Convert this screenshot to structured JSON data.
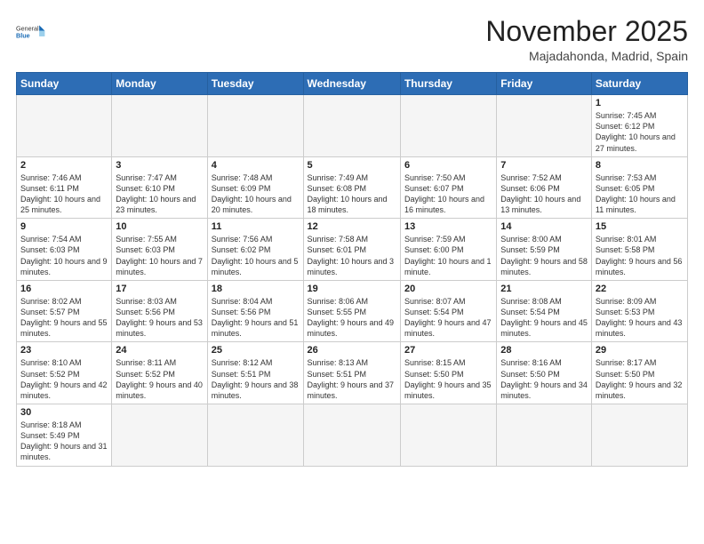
{
  "logo": {
    "text_general": "General",
    "text_blue": "Blue"
  },
  "header": {
    "month_year": "November 2025",
    "location": "Majadahonda, Madrid, Spain"
  },
  "weekdays": [
    "Sunday",
    "Monday",
    "Tuesday",
    "Wednesday",
    "Thursday",
    "Friday",
    "Saturday"
  ],
  "weeks": [
    [
      {
        "day": "",
        "info": ""
      },
      {
        "day": "",
        "info": ""
      },
      {
        "day": "",
        "info": ""
      },
      {
        "day": "",
        "info": ""
      },
      {
        "day": "",
        "info": ""
      },
      {
        "day": "",
        "info": ""
      },
      {
        "day": "1",
        "info": "Sunrise: 7:45 AM\nSunset: 6:12 PM\nDaylight: 10 hours and 27 minutes."
      }
    ],
    [
      {
        "day": "2",
        "info": "Sunrise: 7:46 AM\nSunset: 6:11 PM\nDaylight: 10 hours and 25 minutes."
      },
      {
        "day": "3",
        "info": "Sunrise: 7:47 AM\nSunset: 6:10 PM\nDaylight: 10 hours and 23 minutes."
      },
      {
        "day": "4",
        "info": "Sunrise: 7:48 AM\nSunset: 6:09 PM\nDaylight: 10 hours and 20 minutes."
      },
      {
        "day": "5",
        "info": "Sunrise: 7:49 AM\nSunset: 6:08 PM\nDaylight: 10 hours and 18 minutes."
      },
      {
        "day": "6",
        "info": "Sunrise: 7:50 AM\nSunset: 6:07 PM\nDaylight: 10 hours and 16 minutes."
      },
      {
        "day": "7",
        "info": "Sunrise: 7:52 AM\nSunset: 6:06 PM\nDaylight: 10 hours and 13 minutes."
      },
      {
        "day": "8",
        "info": "Sunrise: 7:53 AM\nSunset: 6:05 PM\nDaylight: 10 hours and 11 minutes."
      }
    ],
    [
      {
        "day": "9",
        "info": "Sunrise: 7:54 AM\nSunset: 6:03 PM\nDaylight: 10 hours and 9 minutes."
      },
      {
        "day": "10",
        "info": "Sunrise: 7:55 AM\nSunset: 6:03 PM\nDaylight: 10 hours and 7 minutes."
      },
      {
        "day": "11",
        "info": "Sunrise: 7:56 AM\nSunset: 6:02 PM\nDaylight: 10 hours and 5 minutes."
      },
      {
        "day": "12",
        "info": "Sunrise: 7:58 AM\nSunset: 6:01 PM\nDaylight: 10 hours and 3 minutes."
      },
      {
        "day": "13",
        "info": "Sunrise: 7:59 AM\nSunset: 6:00 PM\nDaylight: 10 hours and 1 minute."
      },
      {
        "day": "14",
        "info": "Sunrise: 8:00 AM\nSunset: 5:59 PM\nDaylight: 9 hours and 58 minutes."
      },
      {
        "day": "15",
        "info": "Sunrise: 8:01 AM\nSunset: 5:58 PM\nDaylight: 9 hours and 56 minutes."
      }
    ],
    [
      {
        "day": "16",
        "info": "Sunrise: 8:02 AM\nSunset: 5:57 PM\nDaylight: 9 hours and 55 minutes."
      },
      {
        "day": "17",
        "info": "Sunrise: 8:03 AM\nSunset: 5:56 PM\nDaylight: 9 hours and 53 minutes."
      },
      {
        "day": "18",
        "info": "Sunrise: 8:04 AM\nSunset: 5:56 PM\nDaylight: 9 hours and 51 minutes."
      },
      {
        "day": "19",
        "info": "Sunrise: 8:06 AM\nSunset: 5:55 PM\nDaylight: 9 hours and 49 minutes."
      },
      {
        "day": "20",
        "info": "Sunrise: 8:07 AM\nSunset: 5:54 PM\nDaylight: 9 hours and 47 minutes."
      },
      {
        "day": "21",
        "info": "Sunrise: 8:08 AM\nSunset: 5:54 PM\nDaylight: 9 hours and 45 minutes."
      },
      {
        "day": "22",
        "info": "Sunrise: 8:09 AM\nSunset: 5:53 PM\nDaylight: 9 hours and 43 minutes."
      }
    ],
    [
      {
        "day": "23",
        "info": "Sunrise: 8:10 AM\nSunset: 5:52 PM\nDaylight: 9 hours and 42 minutes."
      },
      {
        "day": "24",
        "info": "Sunrise: 8:11 AM\nSunset: 5:52 PM\nDaylight: 9 hours and 40 minutes."
      },
      {
        "day": "25",
        "info": "Sunrise: 8:12 AM\nSunset: 5:51 PM\nDaylight: 9 hours and 38 minutes."
      },
      {
        "day": "26",
        "info": "Sunrise: 8:13 AM\nSunset: 5:51 PM\nDaylight: 9 hours and 37 minutes."
      },
      {
        "day": "27",
        "info": "Sunrise: 8:15 AM\nSunset: 5:50 PM\nDaylight: 9 hours and 35 minutes."
      },
      {
        "day": "28",
        "info": "Sunrise: 8:16 AM\nSunset: 5:50 PM\nDaylight: 9 hours and 34 minutes."
      },
      {
        "day": "29",
        "info": "Sunrise: 8:17 AM\nSunset: 5:50 PM\nDaylight: 9 hours and 32 minutes."
      }
    ],
    [
      {
        "day": "30",
        "info": "Sunrise: 8:18 AM\nSunset: 5:49 PM\nDaylight: 9 hours and 31 minutes."
      },
      {
        "day": "",
        "info": ""
      },
      {
        "day": "",
        "info": ""
      },
      {
        "day": "",
        "info": ""
      },
      {
        "day": "",
        "info": ""
      },
      {
        "day": "",
        "info": ""
      },
      {
        "day": "",
        "info": ""
      }
    ]
  ]
}
